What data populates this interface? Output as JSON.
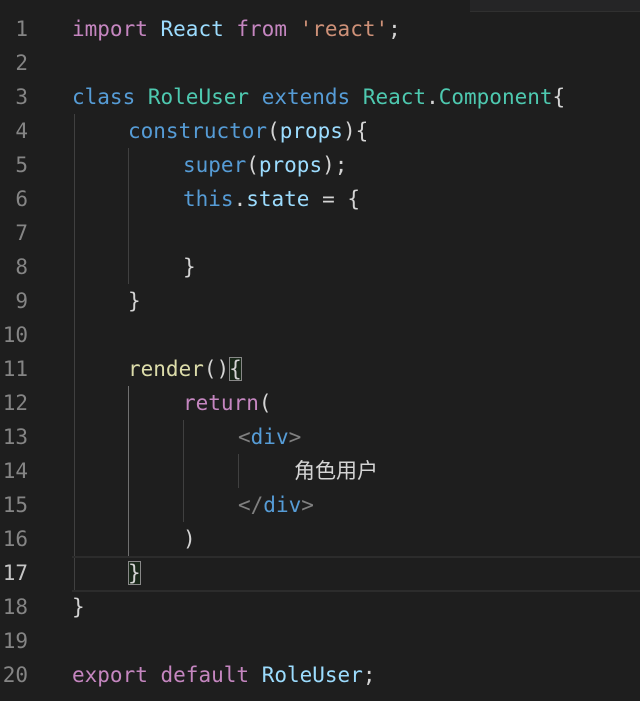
{
  "editor": {
    "lines": [
      {
        "n": "1"
      },
      {
        "n": "2"
      },
      {
        "n": "3"
      },
      {
        "n": "4"
      },
      {
        "n": "5"
      },
      {
        "n": "6"
      },
      {
        "n": "7"
      },
      {
        "n": "8"
      },
      {
        "n": "9"
      },
      {
        "n": "10"
      },
      {
        "n": "11"
      },
      {
        "n": "12"
      },
      {
        "n": "13"
      },
      {
        "n": "14"
      },
      {
        "n": "15"
      },
      {
        "n": "16"
      },
      {
        "n": "17"
      },
      {
        "n": "18"
      },
      {
        "n": "19"
      },
      {
        "n": "20"
      }
    ],
    "tokens": {
      "import": "import",
      "react_name": "React",
      "from": "from",
      "react_str": "'react'",
      "semi": ";",
      "class": "class",
      "class_name": "RoleUser",
      "extends": "extends",
      "react_obj": "React",
      "dot": ".",
      "component": "Component",
      "open_brace": "{",
      "constructor": "constructor",
      "lparen": "(",
      "props": "props",
      "rparen": ")",
      "super": "super",
      "this": "this",
      "state": "state",
      "equals": " = ",
      "close_brace": "}",
      "render": "render",
      "return": "return",
      "lt": "<",
      "lt_slash": "</",
      "div": "div",
      "gt": ">",
      "content_text": "角色用户",
      "export": "export",
      "default": "default",
      "export_name": "RoleUser"
    }
  }
}
